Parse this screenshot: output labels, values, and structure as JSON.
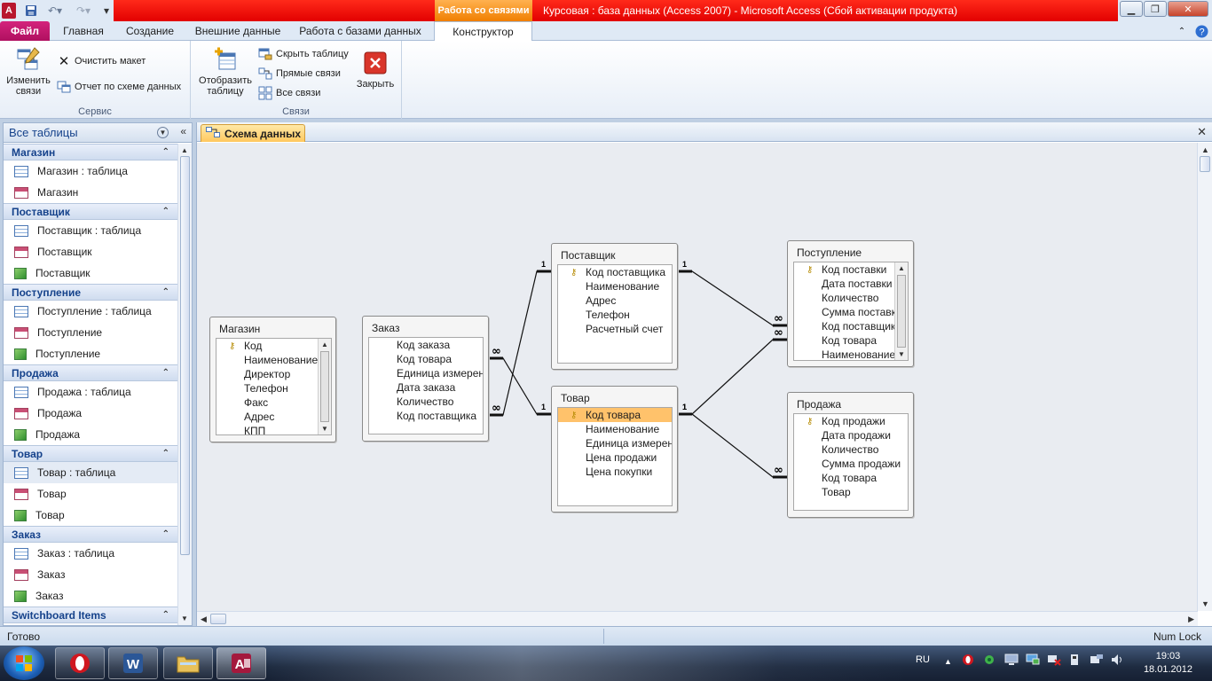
{
  "titlebar": {
    "app_icon": "A",
    "context_tab": "Работа со связями",
    "title": "Курсовая : база данных (Access 2007)  -  Microsoft Access (Сбой активации продукта)"
  },
  "ribbon": {
    "tabs": [
      "Файл",
      "Главная",
      "Создание",
      "Внешние данные",
      "Работа с базами данных",
      "Конструктор"
    ],
    "groups": {
      "service": {
        "label": "Сервис",
        "edit_relations": "Изменить\nсвязи",
        "clear_layout": "Очистить макет",
        "report": "Отчет по схеме данных"
      },
      "relations": {
        "label": "Связи",
        "show_table": "Отобразить\nтаблицу",
        "hide_table": "Скрыть таблицу",
        "direct": "Прямые связи",
        "all": "Все связи",
        "close": "Закрыть"
      }
    }
  },
  "nav": {
    "header": "Все таблицы",
    "groups": [
      {
        "title": "Магазин",
        "items": [
          {
            "type": "table",
            "label": "Магазин : таблица"
          },
          {
            "type": "form",
            "label": "Магазин"
          }
        ]
      },
      {
        "title": "Поставщик",
        "items": [
          {
            "type": "table",
            "label": "Поставщик : таблица"
          },
          {
            "type": "form",
            "label": "Поставщик"
          },
          {
            "type": "report",
            "label": "Поставщик"
          }
        ]
      },
      {
        "title": "Поступление",
        "items": [
          {
            "type": "table",
            "label": "Поступление : таблица"
          },
          {
            "type": "form",
            "label": "Поступление"
          },
          {
            "type": "report",
            "label": "Поступление"
          }
        ]
      },
      {
        "title": "Продажа",
        "items": [
          {
            "type": "table",
            "label": "Продажа : таблица"
          },
          {
            "type": "form",
            "label": "Продажа"
          },
          {
            "type": "report",
            "label": "Продажа"
          }
        ]
      },
      {
        "title": "Товар",
        "items": [
          {
            "type": "table",
            "label": "Товар : таблица",
            "selected": true
          },
          {
            "type": "form",
            "label": "Товар"
          },
          {
            "type": "report",
            "label": "Товар"
          }
        ]
      },
      {
        "title": "Заказ",
        "items": [
          {
            "type": "table",
            "label": "Заказ : таблица"
          },
          {
            "type": "form",
            "label": "Заказ"
          },
          {
            "type": "report",
            "label": "Заказ"
          }
        ]
      },
      {
        "title": "Switchboard Items",
        "items": []
      }
    ]
  },
  "document": {
    "tab_label": "Схема данных"
  },
  "tables": [
    {
      "id": "magazin",
      "title": "Магазин",
      "scroll": true,
      "fields": [
        {
          "name": "Код",
          "key": true
        },
        {
          "name": "Наименование"
        },
        {
          "name": "Директор"
        },
        {
          "name": "Телефон"
        },
        {
          "name": "Факс"
        },
        {
          "name": "Адрес"
        },
        {
          "name": "КПП"
        }
      ]
    },
    {
      "id": "zakaz",
      "title": "Заказ",
      "scroll": false,
      "fields": [
        {
          "name": "Код заказа"
        },
        {
          "name": "Код товара"
        },
        {
          "name": "Единица измерения"
        },
        {
          "name": "Дата заказа"
        },
        {
          "name": "Количество"
        },
        {
          "name": "Код поставщика"
        }
      ]
    },
    {
      "id": "postavshik",
      "title": "Поставщик",
      "scroll": false,
      "fields": [
        {
          "name": "Код поставщика",
          "key": true
        },
        {
          "name": "Наименование"
        },
        {
          "name": "Адрес"
        },
        {
          "name": "Телефон"
        },
        {
          "name": "Расчетный счет"
        }
      ]
    },
    {
      "id": "tovar",
      "title": "Товар",
      "scroll": false,
      "fields": [
        {
          "name": "Код товара",
          "key": true,
          "highlight": true
        },
        {
          "name": "Наименование"
        },
        {
          "name": "Единица измерения"
        },
        {
          "name": "Цена продажи"
        },
        {
          "name": "Цена покупки"
        }
      ]
    },
    {
      "id": "postuplenie",
      "title": "Поступление",
      "scroll": true,
      "fields": [
        {
          "name": "Код поставки",
          "key": true
        },
        {
          "name": "Дата поставки"
        },
        {
          "name": "Количество"
        },
        {
          "name": "Сумма поставки"
        },
        {
          "name": "Код  поставщика"
        },
        {
          "name": "Код товара"
        },
        {
          "name": "Наименование"
        }
      ]
    },
    {
      "id": "prodazha",
      "title": "Продажа",
      "scroll": false,
      "fields": [
        {
          "name": "Код продажи",
          "key": true
        },
        {
          "name": "Дата продажи"
        },
        {
          "name": "Количество"
        },
        {
          "name": "Сумма продажи"
        },
        {
          "name": "Код товара"
        },
        {
          "name": "Товар"
        }
      ]
    }
  ],
  "relationships": [
    {
      "from": "postavshik.Код поставщика",
      "to": "zakaz.Код поставщика",
      "one_label": "1",
      "many_label": "∞"
    },
    {
      "from": "tovar.Код товара",
      "to": "zakaz.Код товара",
      "one_label": "1",
      "many_label": "∞"
    },
    {
      "from": "postavshik.Код поставщика",
      "to": "postuplenie.Код  поставщика",
      "one_label": "1",
      "many_label": "∞"
    },
    {
      "from": "tovar.Код товара",
      "to": "postuplenie.Код товара",
      "one_label": "1",
      "many_label": "∞"
    },
    {
      "from": "tovar.Код товара",
      "to": "prodazha.Код товара",
      "one_label": "1",
      "many_label": "∞"
    }
  ],
  "status": {
    "left": "Готово",
    "right": "Num Lock"
  },
  "taskbar": {
    "lang": "RU",
    "time": "19:03",
    "date": "18.01.2012"
  },
  "colors": {
    "title_red": "#e20000",
    "context_orange": "#f07f00",
    "file_tab": "#b01060",
    "highlight_field": "#ffc26b",
    "canvas_bg": "#e9ecf1"
  }
}
